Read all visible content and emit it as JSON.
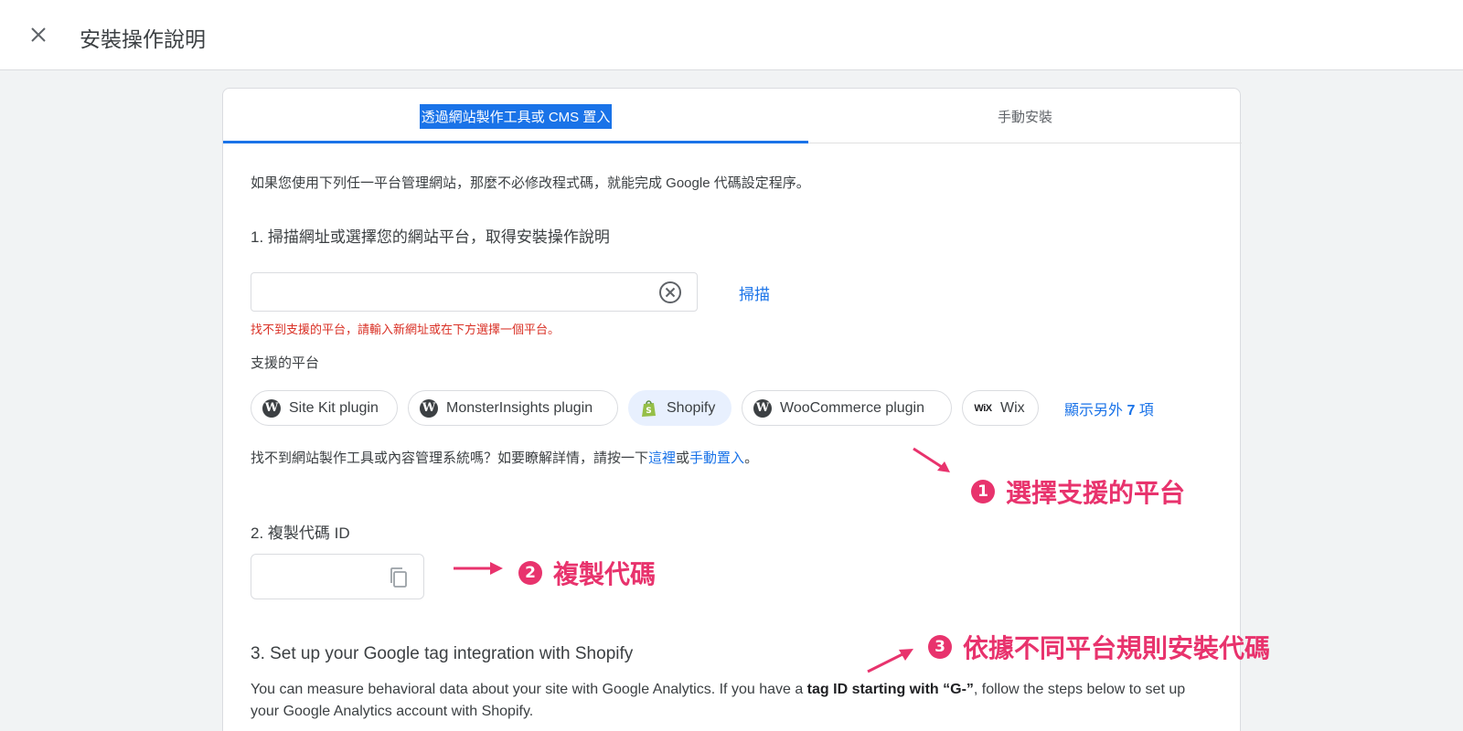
{
  "header": {
    "title": "安裝操作說明"
  },
  "tabs": [
    {
      "label": "透過網站製作工具或 CMS 置入",
      "active": true
    },
    {
      "label": "手動安裝",
      "active": false
    }
  ],
  "intro": "如果您使用下列任一平台管理網站，那麼不必修改程式碼，就能完成 Google 代碼設定程序。",
  "step1": {
    "title": "1. 掃描網址或選擇您的網站平台，取得安裝操作說明",
    "input_value": "",
    "scan_label": "掃描",
    "error": "找不到支援的平台，請輸入新網址或在下方選擇一個平台。",
    "platforms_label": "支援的平台",
    "platforms": [
      {
        "label": "Site Kit plugin",
        "icon": "wordpress-icon"
      },
      {
        "label": "MonsterInsights plugin",
        "icon": "wordpress-icon"
      },
      {
        "label": "Shopify",
        "icon": "shopify-icon",
        "selected": true
      },
      {
        "label": "WooCommerce plugin",
        "icon": "wordpress-icon"
      },
      {
        "label": "Wix",
        "icon": "wix-icon"
      }
    ],
    "wix_logo_text": "WiX",
    "show_more_prefix": "顯示另外 ",
    "show_more_count": "7",
    "show_more_suffix": " 項",
    "help_prefix": "找不到網站製作工具或內容管理系統嗎？如要瞭解詳情，請按一下",
    "help_link1": "這裡",
    "help_middle": "或",
    "help_link2": "手動置入",
    "help_suffix": "。"
  },
  "step2": {
    "title": "2. 複製代碼 ID",
    "tag_id": ""
  },
  "step3": {
    "title": "3. Set up your Google tag integration with Shopify",
    "desc_prefix": "You can measure behavioral data about your site with Google Analytics. If you have a ",
    "desc_bold": "tag ID starting with “G-”",
    "desc_suffix": ", follow the steps below to set up your Google Analytics account with Shopify."
  },
  "annotations": [
    {
      "num": "1",
      "text": "選擇支援的平台"
    },
    {
      "num": "2",
      "text": "複製代碼"
    },
    {
      "num": "3",
      "text": "依據不同平台規則安裝代碼"
    }
  ],
  "colors": {
    "accent": "#1a73e8",
    "error": "#d93025",
    "annotation": "#e8336d"
  }
}
